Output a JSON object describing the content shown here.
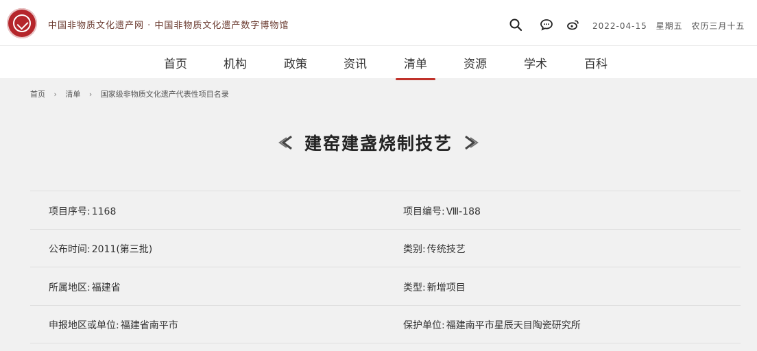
{
  "header": {
    "site_name": "中国非物质文化遗产网 · 中国非物质文化遗产数字博物馆",
    "date": "2022-04-15",
    "weekday": "星期五",
    "lunar": "农历三月十五"
  },
  "nav": {
    "items": [
      {
        "label": "首页"
      },
      {
        "label": "机构"
      },
      {
        "label": "政策"
      },
      {
        "label": "资讯"
      },
      {
        "label": "清单"
      },
      {
        "label": "资源"
      },
      {
        "label": "学术"
      },
      {
        "label": "百科"
      }
    ],
    "active": "清单"
  },
  "breadcrumb": {
    "items": [
      "首页",
      "清单",
      "国家级非物质文化遗产代表性项目名录"
    ]
  },
  "title": "建窑建盏烧制技艺",
  "info": {
    "serial_label": "项目序号:",
    "serial_value": "1168",
    "code_label": "项目编号:",
    "code_value": "Ⅷ-188",
    "publish_label": "公布时间:",
    "publish_value": "2011(第三批)",
    "category_label": "类别:",
    "category_value": "传统技艺",
    "region_label": "所属地区:",
    "region_value": "福建省",
    "type_label": "类型:",
    "type_value": "新增项目",
    "applicant_label": "申报地区或单位:",
    "applicant_value": "福建省南平市",
    "protector_label": "保护单位:",
    "protector_value": "福建南平市星辰天目陶瓷研究所"
  },
  "colors": {
    "accent": "#c0312a",
    "logo": "#b5262b",
    "background": "#f1f1f1"
  },
  "icons": [
    "search-icon",
    "chat-icon",
    "weibo-icon"
  ]
}
